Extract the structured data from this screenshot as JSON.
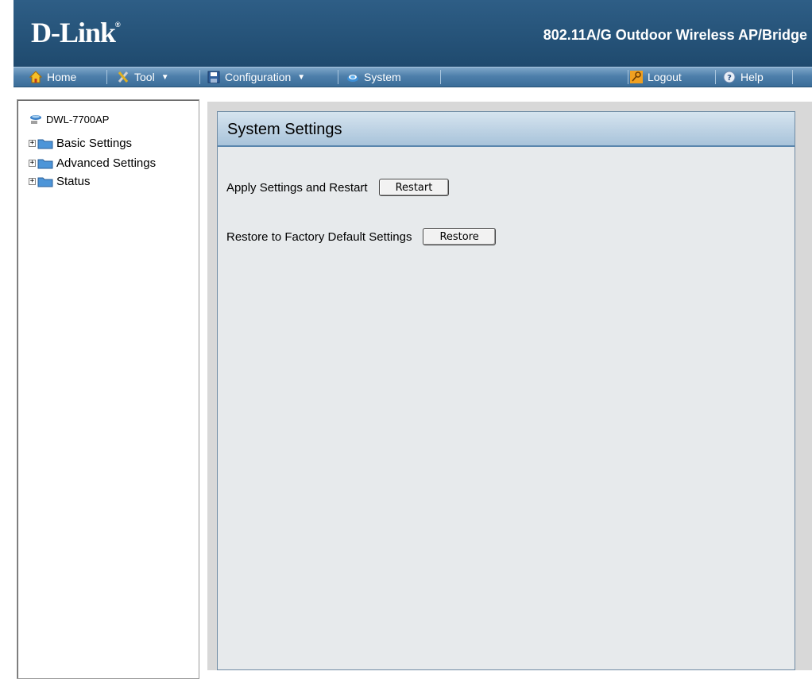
{
  "header": {
    "logo": "D-Link",
    "logo_mark": "®",
    "product_title": "802.11A/G Outdoor Wireless AP/Bridge",
    "bg_color": "#2a5882"
  },
  "menubar": {
    "home": "Home",
    "tool": "Tool",
    "configuration": "Configuration",
    "system": "System",
    "logout": "Logout",
    "help": "Help"
  },
  "sidebar": {
    "root": "DWL-7700AP",
    "items": [
      {
        "label": "Basic Settings",
        "expander": "+"
      },
      {
        "label": "Advanced Settings",
        "expander": "+"
      },
      {
        "label": "Status",
        "expander": "+"
      }
    ]
  },
  "main": {
    "title": "System Settings",
    "rows": [
      {
        "label": "Apply Settings and Restart",
        "button": "Restart"
      },
      {
        "label": "Restore to Factory Default Settings",
        "button": "Restore"
      }
    ]
  }
}
